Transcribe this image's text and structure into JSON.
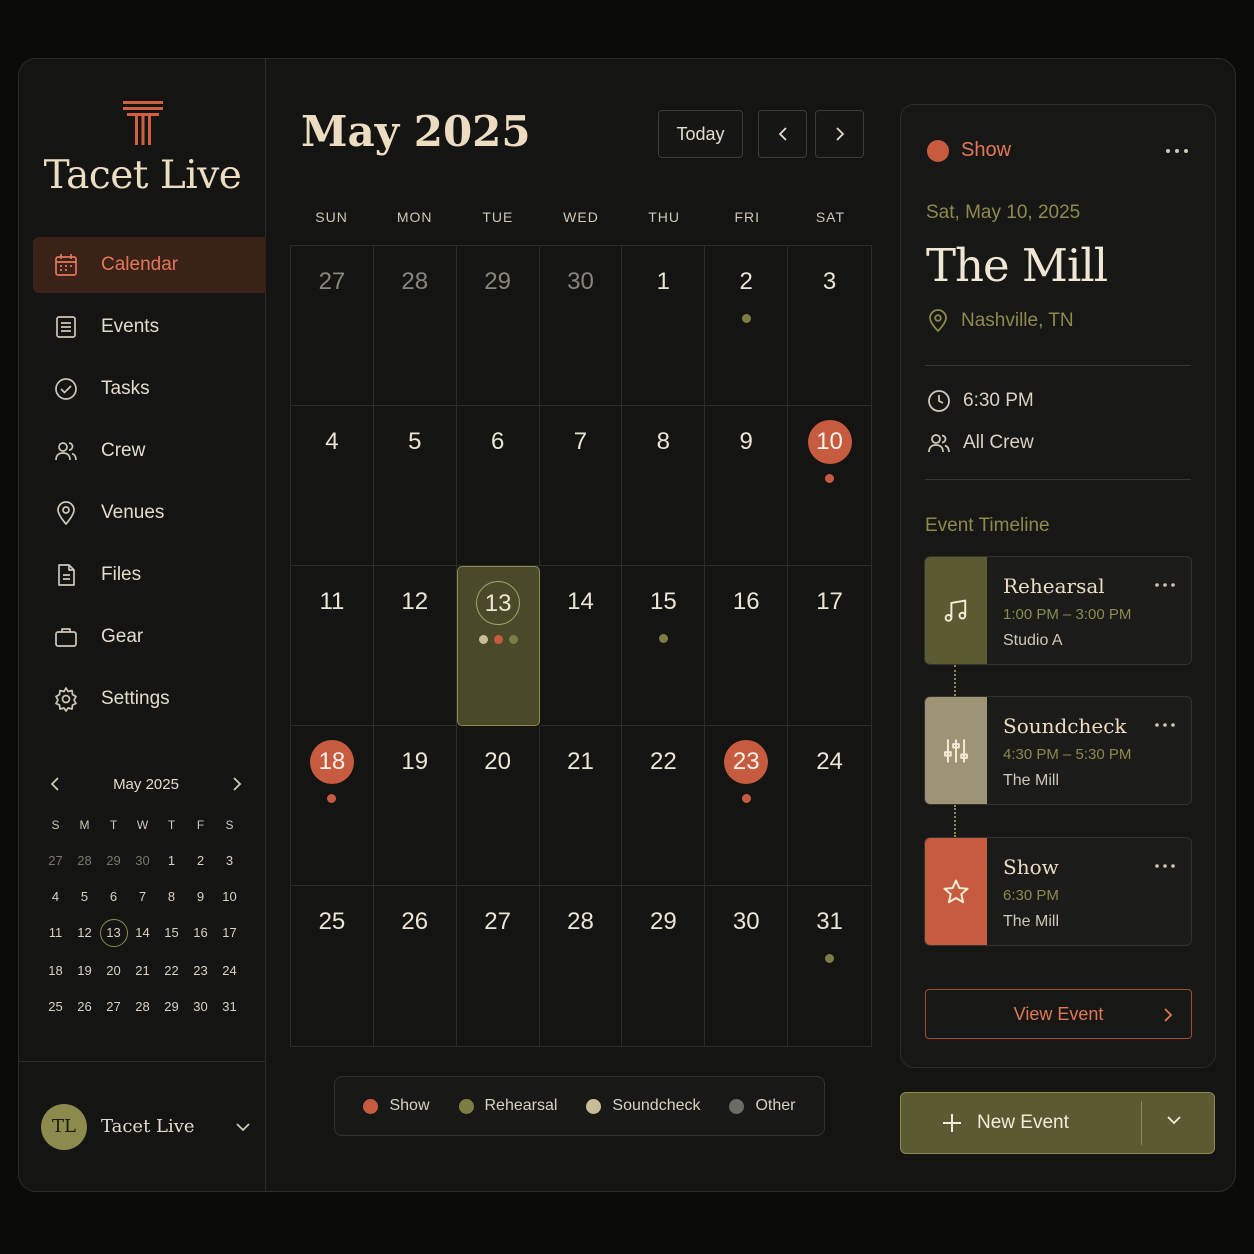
{
  "brand": {
    "name": "Tacet Live"
  },
  "nav": [
    {
      "label": "Calendar",
      "icon": "calendar-icon",
      "active": true
    },
    {
      "label": "Events",
      "icon": "events-icon"
    },
    {
      "label": "Tasks",
      "icon": "tasks-icon"
    },
    {
      "label": "Crew",
      "icon": "crew-icon"
    },
    {
      "label": "Venues",
      "icon": "venues-icon"
    },
    {
      "label": "Files",
      "icon": "files-icon"
    },
    {
      "label": "Gear",
      "icon": "gear-icon"
    },
    {
      "label": "Settings",
      "icon": "settings-icon"
    }
  ],
  "mini_calendar": {
    "title": "May 2025",
    "weekdays": [
      "S",
      "M",
      "T",
      "W",
      "T",
      "F",
      "S"
    ],
    "days": [
      "27",
      "28",
      "29",
      "30",
      "1",
      "2",
      "3",
      "4",
      "5",
      "6",
      "7",
      "8",
      "9",
      "10",
      "11",
      "12",
      "13",
      "14",
      "15",
      "16",
      "17",
      "18",
      "19",
      "20",
      "21",
      "22",
      "23",
      "24",
      "25",
      "26",
      "27",
      "28",
      "29",
      "30",
      "31"
    ],
    "muted_count": 4,
    "today": "13"
  },
  "user": {
    "initials": "TL",
    "name": "Tacet Live"
  },
  "calendar": {
    "title": "May 2025",
    "today_label": "Today",
    "weekdays": [
      "SUN",
      "MON",
      "TUE",
      "WED",
      "THU",
      "FRI",
      "SAT"
    ],
    "days": [
      {
        "n": "27",
        "muted": true
      },
      {
        "n": "28",
        "muted": true
      },
      {
        "n": "29",
        "muted": true
      },
      {
        "n": "30",
        "muted": true
      },
      {
        "n": "1"
      },
      {
        "n": "2",
        "dots": [
          "rehearsal"
        ]
      },
      {
        "n": "3"
      },
      {
        "n": "4"
      },
      {
        "n": "5"
      },
      {
        "n": "6"
      },
      {
        "n": "7"
      },
      {
        "n": "8"
      },
      {
        "n": "9"
      },
      {
        "n": "10",
        "show": true,
        "dots": [
          "show"
        ]
      },
      {
        "n": "11"
      },
      {
        "n": "12"
      },
      {
        "n": "13",
        "selected": true,
        "dots": [
          "soundcheck",
          "show",
          "rehearsal"
        ]
      },
      {
        "n": "14"
      },
      {
        "n": "15",
        "dots": [
          "rehearsal"
        ]
      },
      {
        "n": "16"
      },
      {
        "n": "17"
      },
      {
        "n": "18",
        "show": true,
        "dots": [
          "show"
        ]
      },
      {
        "n": "19"
      },
      {
        "n": "20"
      },
      {
        "n": "21"
      },
      {
        "n": "22"
      },
      {
        "n": "23",
        "show": true,
        "dots": [
          "show"
        ]
      },
      {
        "n": "24"
      },
      {
        "n": "25"
      },
      {
        "n": "26"
      },
      {
        "n": "27"
      },
      {
        "n": "28"
      },
      {
        "n": "29"
      },
      {
        "n": "30"
      },
      {
        "n": "31",
        "dots": [
          "rehearsal"
        ]
      }
    ]
  },
  "legend": [
    {
      "label": "Show",
      "color": "#c75b3f"
    },
    {
      "label": "Rehearsal",
      "color": "#7e7d45"
    },
    {
      "label": "Soundcheck",
      "color": "#c8bd98"
    },
    {
      "label": "Other",
      "color": "#6e6c66"
    }
  ],
  "colors": {
    "show": "#c75b3f",
    "rehearsal": "#7e7d45",
    "soundcheck": "#c8bd98",
    "other": "#6e6c66",
    "accent": "#e27757",
    "olive": "#8c8a4c"
  },
  "event": {
    "type": "Show",
    "date": "Sat, May 10, 2025",
    "venue": "The Mill",
    "location": "Nashville, TN",
    "time": "6:30 PM",
    "crew": "All Crew",
    "timeline_title": "Event Timeline",
    "timeline": [
      {
        "name": "Rehearsal",
        "time": "1:00 PM – 3:00 PM",
        "place": "Studio A",
        "icon": "music-note-icon",
        "color": "#5c5a32"
      },
      {
        "name": "Soundcheck",
        "time": "4:30 PM – 5:30 PM",
        "place": "The Mill",
        "icon": "sliders-icon",
        "color": "#9c9474"
      },
      {
        "name": "Show",
        "time": "6:30 PM",
        "place": "The Mill",
        "icon": "star-icon",
        "color": "#c75b3f"
      }
    ],
    "view_label": "View Event"
  },
  "new_event_label": "New Event"
}
